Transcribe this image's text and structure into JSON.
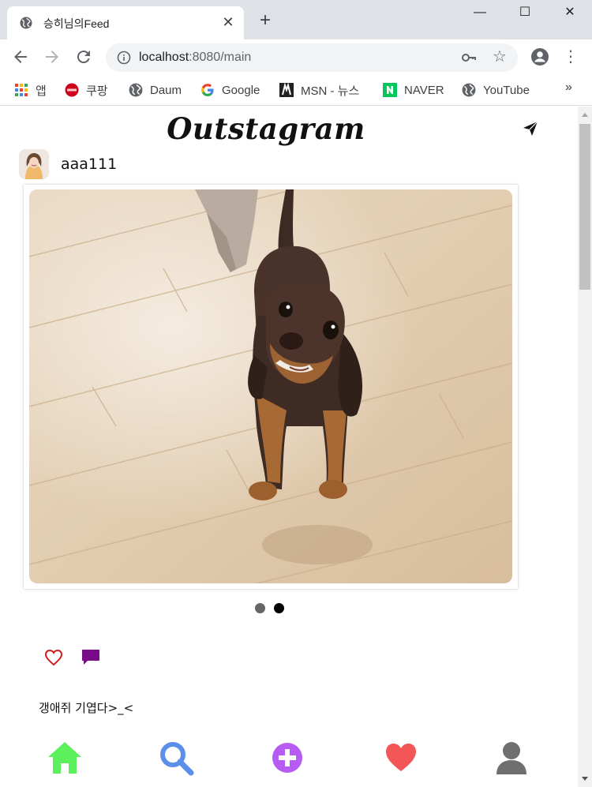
{
  "browser": {
    "tab_title": "승히님의Feed",
    "new_tab": "+",
    "url_host": "localhost",
    "url_rest": ":8080/main",
    "window_controls": {
      "minimize": "—",
      "maximize": "☐",
      "close": "✕"
    },
    "bookmarks": [
      {
        "label": "앱",
        "icon": "apps-grid-icon"
      },
      {
        "label": "쿠팡",
        "icon": "coupang-icon"
      },
      {
        "label": "Daum",
        "icon": "globe-icon"
      },
      {
        "label": "Google",
        "icon": "google-icon"
      },
      {
        "label": "MSN - 뉴스",
        "icon": "msn-icon"
      },
      {
        "label": "NAVER",
        "icon": "naver-icon"
      },
      {
        "label": "YouTube",
        "icon": "globe-icon"
      }
    ],
    "bookmarks_more": "»"
  },
  "page": {
    "brand": "Outstagram",
    "post": {
      "username": "aaa111",
      "caption": "갱애쥐 기엽다>_<",
      "slides_total": 2,
      "active_slide": 2,
      "image_description_icon": "dog-photo"
    },
    "bottom_nav": [
      {
        "name": "home",
        "icon": "home-icon",
        "color": "#5cf05c"
      },
      {
        "name": "search",
        "icon": "search-icon",
        "color": "#5b8fe8"
      },
      {
        "name": "upload",
        "icon": "plus-circle-icon",
        "color": "#b65cf2"
      },
      {
        "name": "likes",
        "icon": "heart-icon",
        "color": "#f25656"
      },
      {
        "name": "profile",
        "icon": "user-icon",
        "color": "#6f6f6f"
      }
    ]
  },
  "colors": {
    "like_outline": "#d11a1a",
    "comment": "#7a0a8a",
    "dot_inactive": "#666666",
    "dot_active": "#000000"
  }
}
